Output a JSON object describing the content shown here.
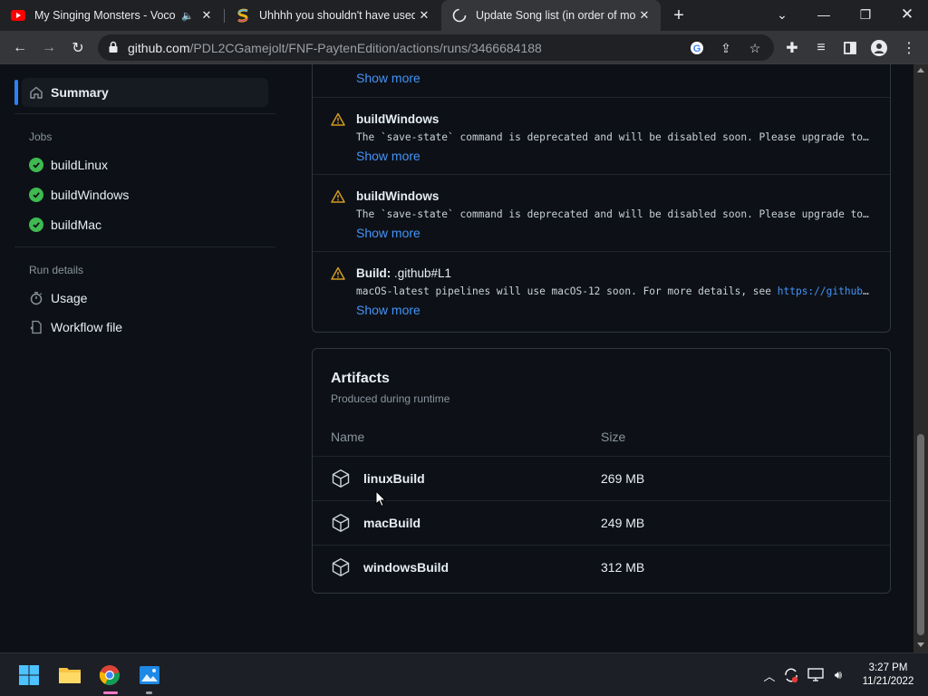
{
  "browser": {
    "tabs": [
      {
        "title": "My Singing Monsters - Voco",
        "icon": "youtube-icon",
        "muted": true,
        "active": false
      },
      {
        "title": "Uhhhh you shouldn't have used t",
        "icon": "rainbow-s-icon",
        "muted": false,
        "active": false
      },
      {
        "title": "Update Song list (in order of mo",
        "icon": "github-icon",
        "muted": false,
        "active": true
      }
    ],
    "url_domain": "github.com",
    "url_path": "/PDL2CGamejolt/FNF-PaytenEdition/actions/runs/3466684188"
  },
  "sidebar": {
    "summary_label": "Summary",
    "jobs_heading": "Jobs",
    "jobs": [
      {
        "label": "buildLinux",
        "status": "success"
      },
      {
        "label": "buildWindows",
        "status": "success"
      },
      {
        "label": "buildMac",
        "status": "success"
      }
    ],
    "run_details_heading": "Run details",
    "run_details": [
      {
        "label": "Usage",
        "icon": "stopwatch-icon"
      },
      {
        "label": "Workflow file",
        "icon": "workflow-file-icon"
      }
    ]
  },
  "annotations": {
    "top_show_more": "Show more",
    "items": [
      {
        "title": "buildWindows",
        "title_suffix": "",
        "message": "The `save-state` command is deprecated and will be disabled soon. Please upgrade to using Environment Files.",
        "link": "",
        "show_more": "Show more"
      },
      {
        "title": "buildWindows",
        "title_suffix": "",
        "message": "The `save-state` command is deprecated and will be disabled soon. Please upgrade to using Environment Files.",
        "link": "",
        "show_more": "Show more"
      },
      {
        "title": "Build:",
        "title_suffix": " .github#L1",
        "message": "macOS-latest pipelines will use macOS-12 soon. For more details, see ",
        "link": "https://github.c…",
        "show_more": "Show more"
      }
    ]
  },
  "artifacts": {
    "title": "Artifacts",
    "subtitle": "Produced during runtime",
    "columns": {
      "name": "Name",
      "size": "Size"
    },
    "rows": [
      {
        "name": "linuxBuild",
        "size": "269 MB"
      },
      {
        "name": "macBuild",
        "size": "249 MB"
      },
      {
        "name": "windowsBuild",
        "size": "312 MB"
      }
    ]
  },
  "taskbar": {
    "time": "3:27 PM",
    "date": "11/21/2022"
  },
  "colors": {
    "success": "#3fb950",
    "warning": "#d29922",
    "link": "#4493f8",
    "page_bg": "#0d1117"
  }
}
